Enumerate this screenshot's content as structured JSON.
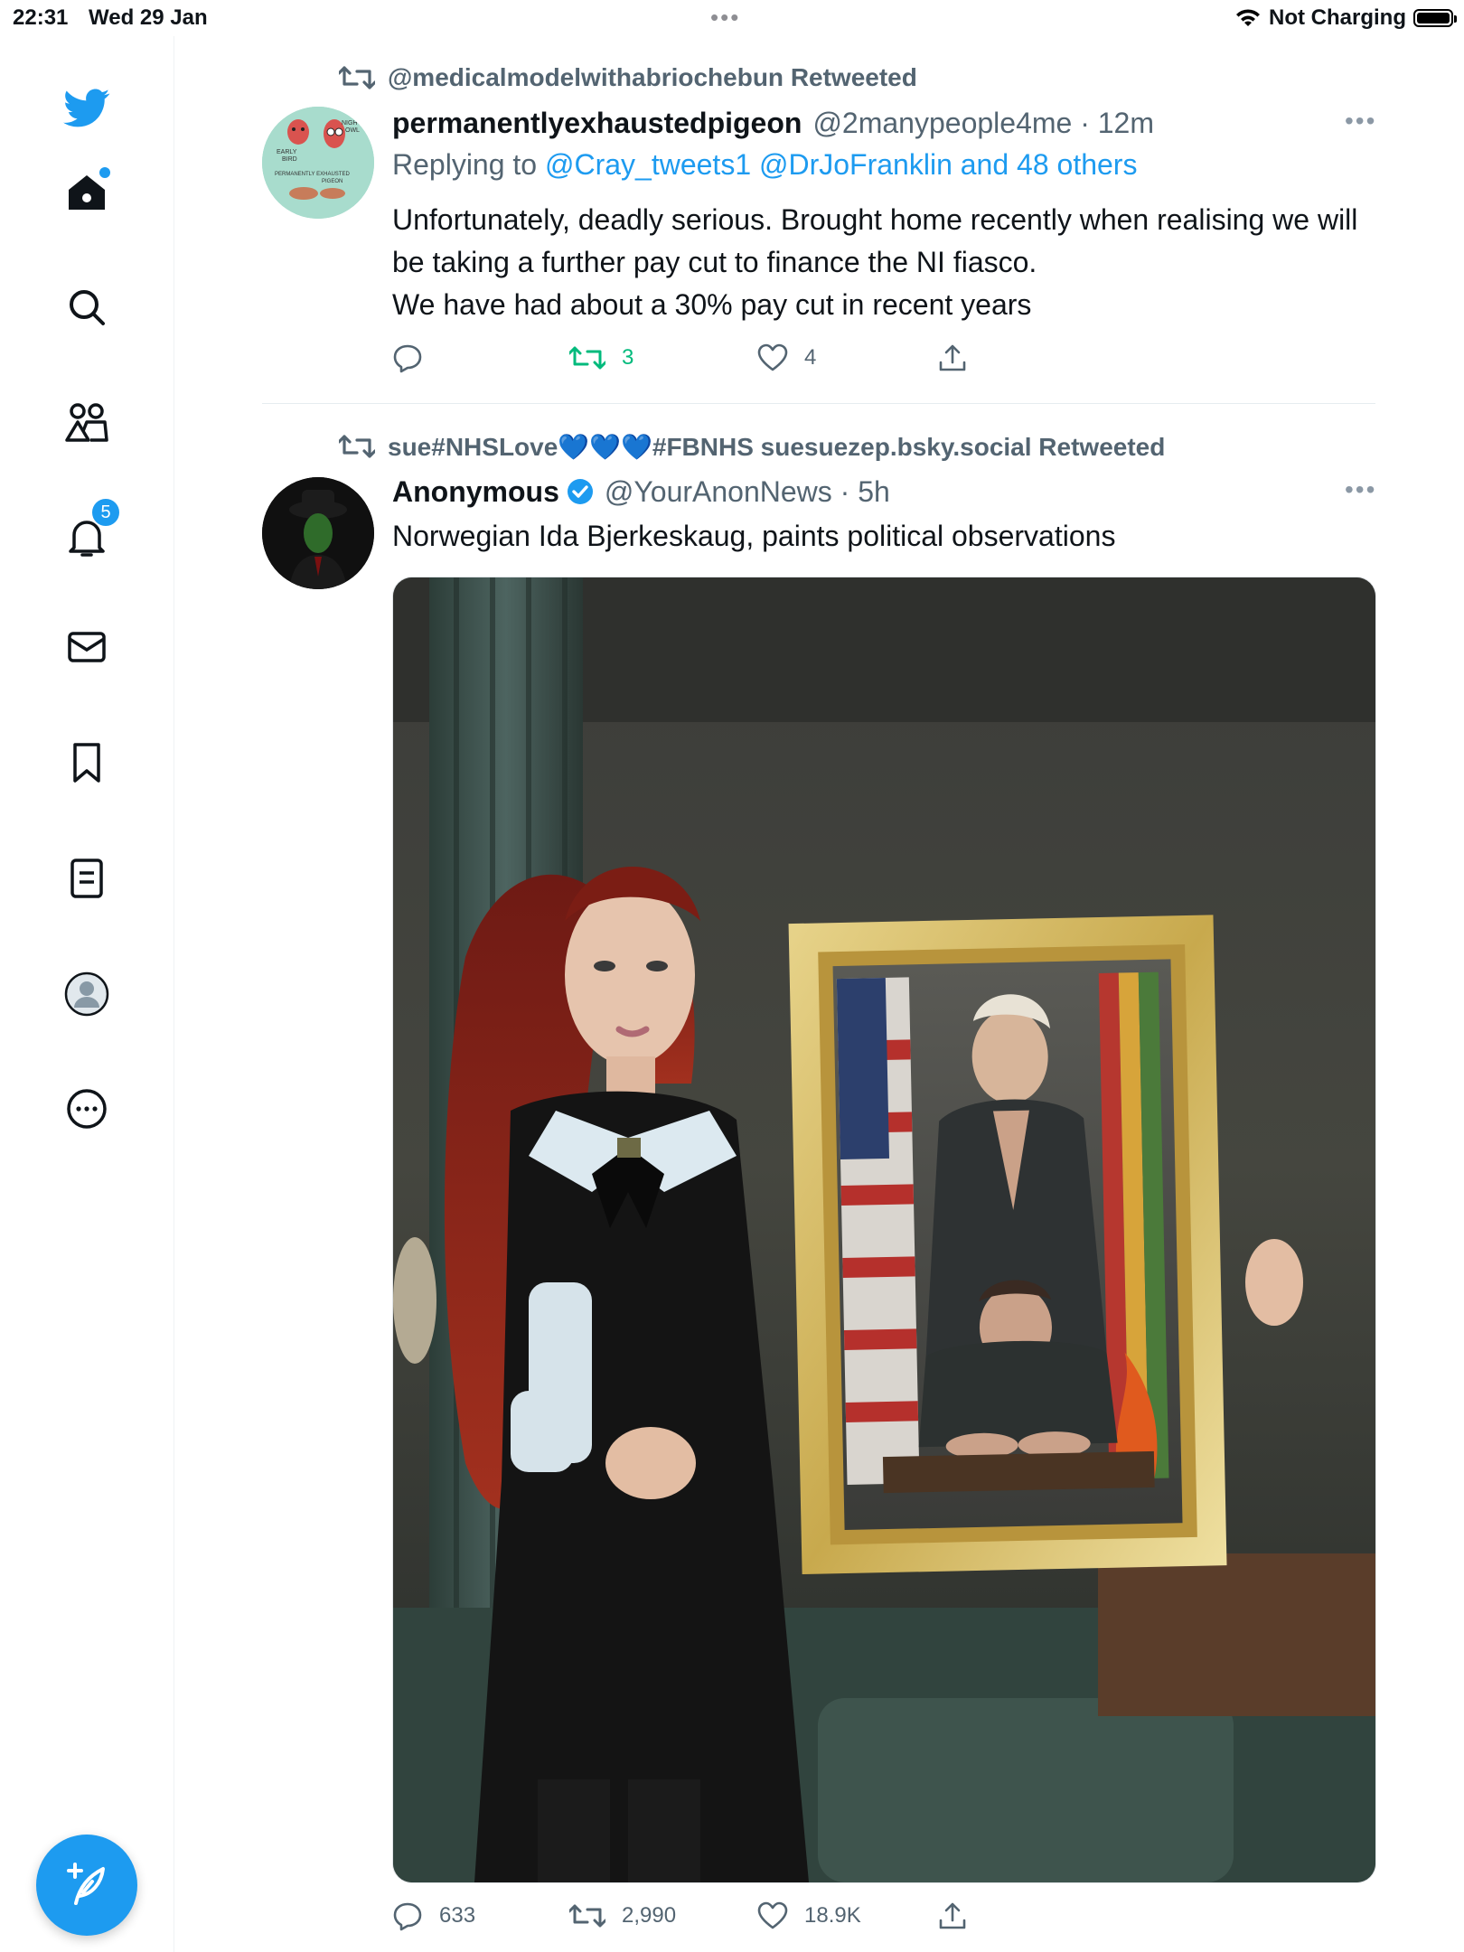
{
  "status_bar": {
    "time": "22:31",
    "date": "Wed 29 Jan",
    "charging": "Not Charging"
  },
  "sidebar": {
    "items": [
      {
        "name": "home",
        "icon": "home-icon"
      },
      {
        "name": "explore",
        "icon": "search-icon"
      },
      {
        "name": "communities",
        "icon": "communities-icon"
      },
      {
        "name": "notifications",
        "icon": "bell-icon",
        "badge": "5"
      },
      {
        "name": "messages",
        "icon": "mail-icon"
      },
      {
        "name": "bookmarks",
        "icon": "bookmark-icon"
      },
      {
        "name": "lists",
        "icon": "lists-icon"
      },
      {
        "name": "profile",
        "icon": "profile-icon"
      },
      {
        "name": "more",
        "icon": "more-circle-icon"
      }
    ],
    "compose_icon": "compose-icon"
  },
  "tweets": [
    {
      "retweeted_by": "@medicalmodelwithabriochebun Retweeted",
      "name": "permanentlyexhaustedpigeon",
      "handle": "@2manypeople4me · 12m",
      "reply_prefix": "Replying to ",
      "reply_to": "@Cray_tweets1 @DrJoFranklin and 48 others",
      "avatar_labels": {
        "early": "EARLY",
        "bird": "BIRD",
        "night": "NIGHT",
        "owl": "OWL",
        "footer1": "PERMANENTLY EXHAUSTED",
        "footer2": "PIGEON"
      },
      "text": "Unfortunately, deadly serious. Brought home recently when realising we will be taking a further pay cut to finance the NI fiasco.\nWe have had about a 30% pay cut in recent years",
      "replies": "",
      "retweets": "3",
      "likes": "4"
    },
    {
      "retweeted_by": "sue#NHSLove💙💙💙#FBNHS suesuezep.bsky.social Retweeted",
      "name": "Anonymous",
      "handle": "@YourAnonNews · 5h",
      "text": "Norwegian Ida Bjerkeskaug, paints political observations",
      "replies": "633",
      "retweets": "2,990",
      "likes": "18.9K"
    }
  ],
  "colors": {
    "accent": "#1d9bf0",
    "retweet_active": "#00ba7c",
    "secondary_text": "#536471"
  }
}
